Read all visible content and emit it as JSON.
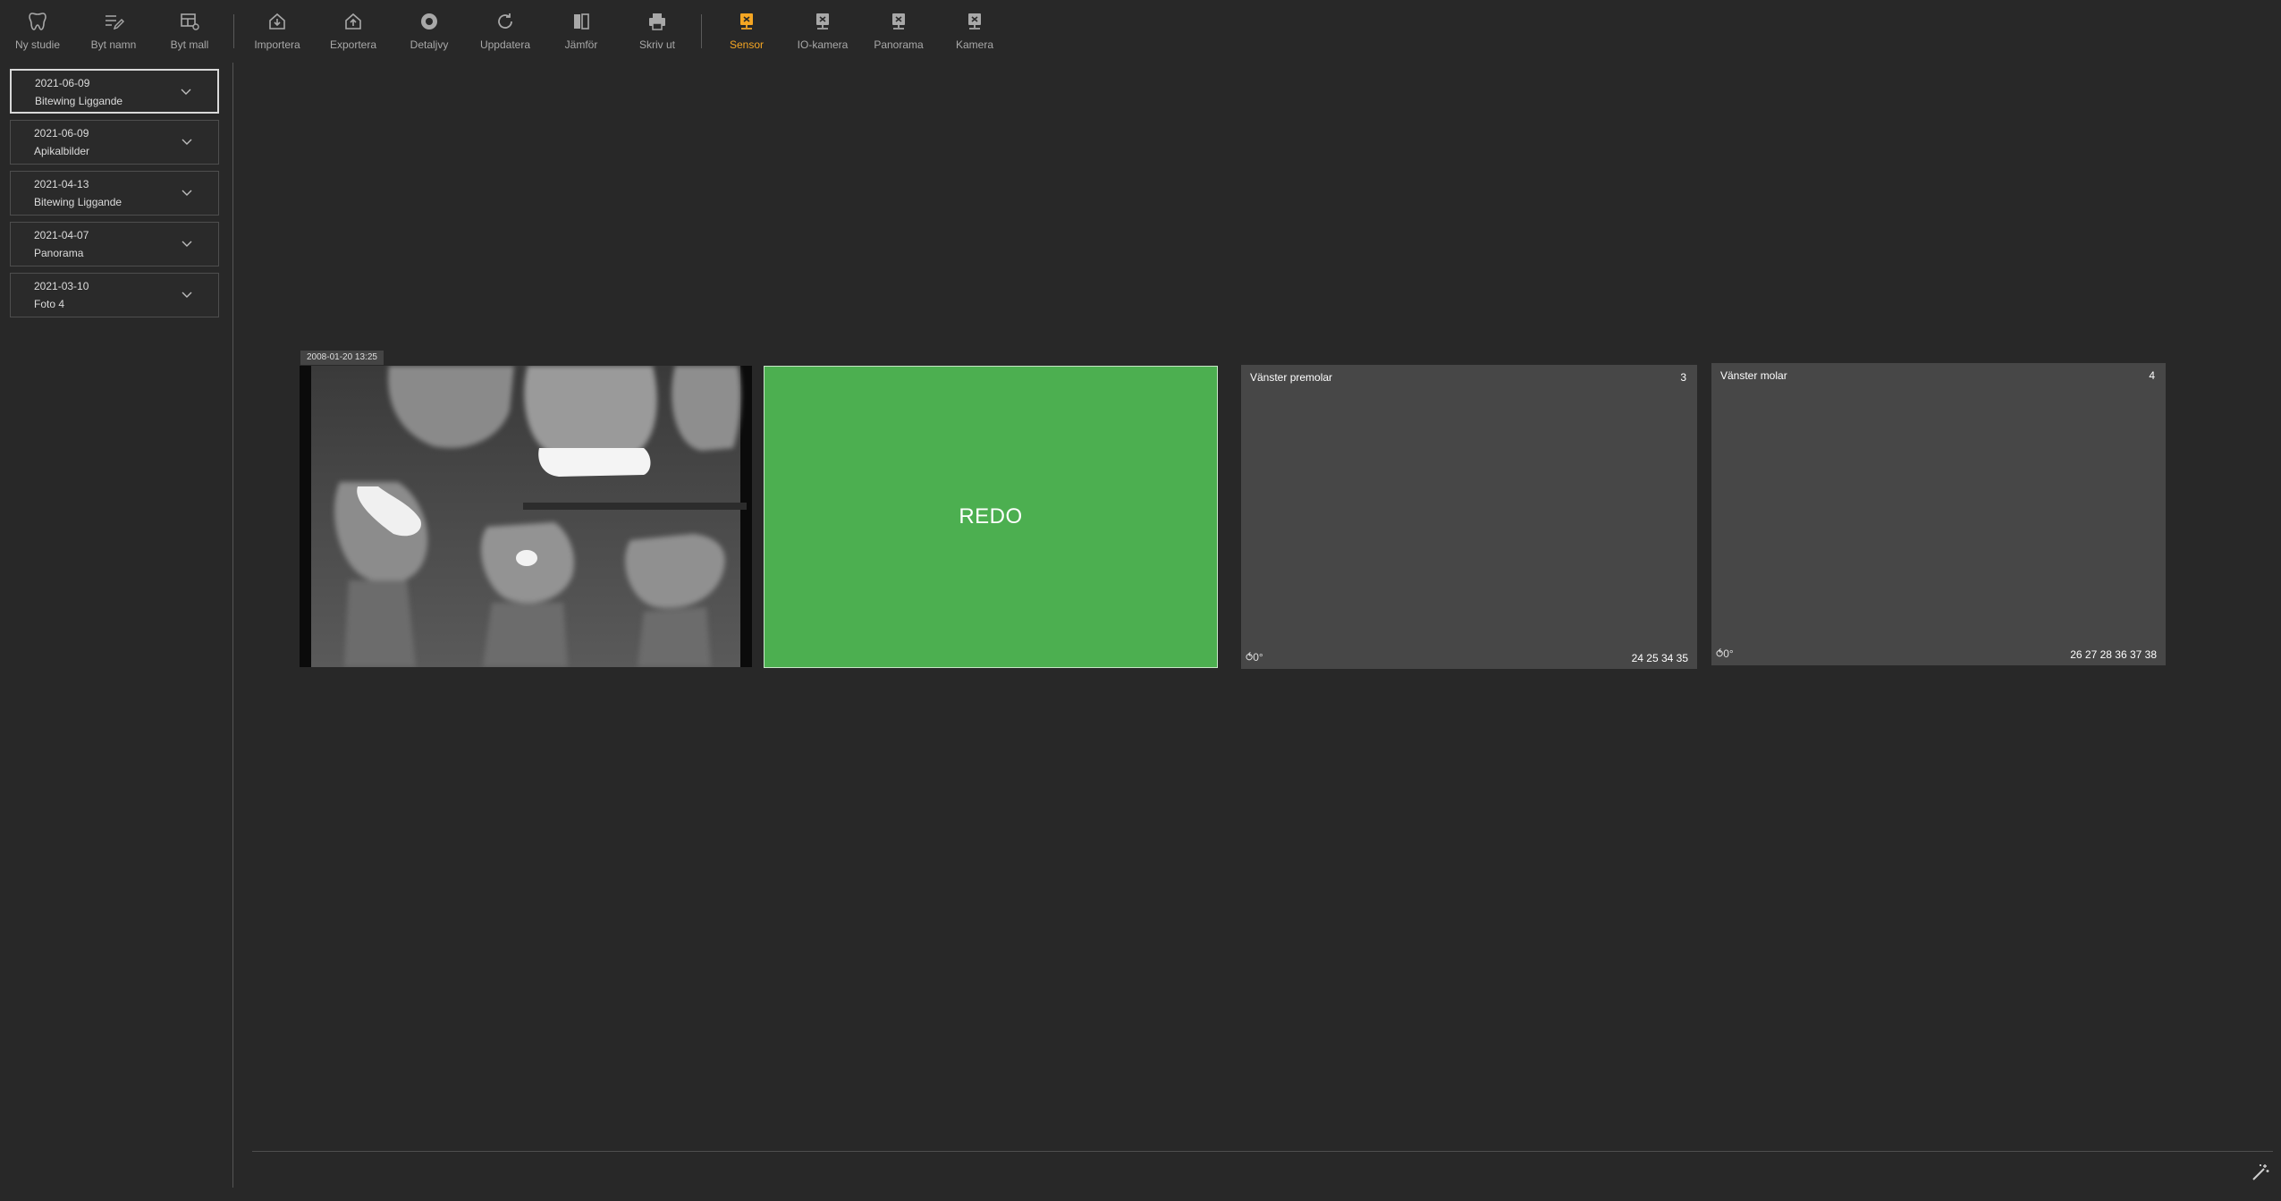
{
  "toolbar": {
    "items": [
      {
        "label": "Ny studie",
        "icon": "tooth-icon"
      },
      {
        "label": "Byt namn",
        "icon": "rename-icon"
      },
      {
        "label": "Byt mall",
        "icon": "template-icon"
      },
      {
        "label": "Importera",
        "icon": "import-icon"
      },
      {
        "label": "Exportera",
        "icon": "export-icon"
      },
      {
        "label": "Detaljvy",
        "icon": "eye-icon"
      },
      {
        "label": "Uppdatera",
        "icon": "refresh-icon"
      },
      {
        "label": "Jämför",
        "icon": "compare-icon"
      },
      {
        "label": "Skriv ut",
        "icon": "printer-icon"
      },
      {
        "label": "Sensor",
        "icon": "sensor-icon",
        "active": true
      },
      {
        "label": "IO-kamera",
        "icon": "io-camera-icon"
      },
      {
        "label": "Panorama",
        "icon": "panorama-icon"
      },
      {
        "label": "Kamera",
        "icon": "camera-icon"
      }
    ],
    "active_color": "#f5a623"
  },
  "studies": [
    {
      "date": "2021-06-09",
      "name": "Bitewing Liggande",
      "selected": true
    },
    {
      "date": "2021-06-09",
      "name": "Apikalbilder"
    },
    {
      "date": "2021-04-13",
      "name": "Bitewing Liggande"
    },
    {
      "date": "2021-04-07",
      "name": "Panorama"
    },
    {
      "date": "2021-03-10",
      "name": "Foto 4"
    }
  ],
  "slots": {
    "image": {
      "timestamp": "2008-01-20 13:25"
    },
    "redo": {
      "label": "REDO",
      "color": "#4caf50"
    },
    "empty": [
      {
        "title": "Vänster premolar",
        "number": "3",
        "teeth": "24 25 34 35",
        "icon": "⥀0°"
      },
      {
        "title": "Vänster molar",
        "number": "4",
        "teeth": "26 27 28 36 37 38",
        "icon": "⥀0°"
      }
    ]
  }
}
